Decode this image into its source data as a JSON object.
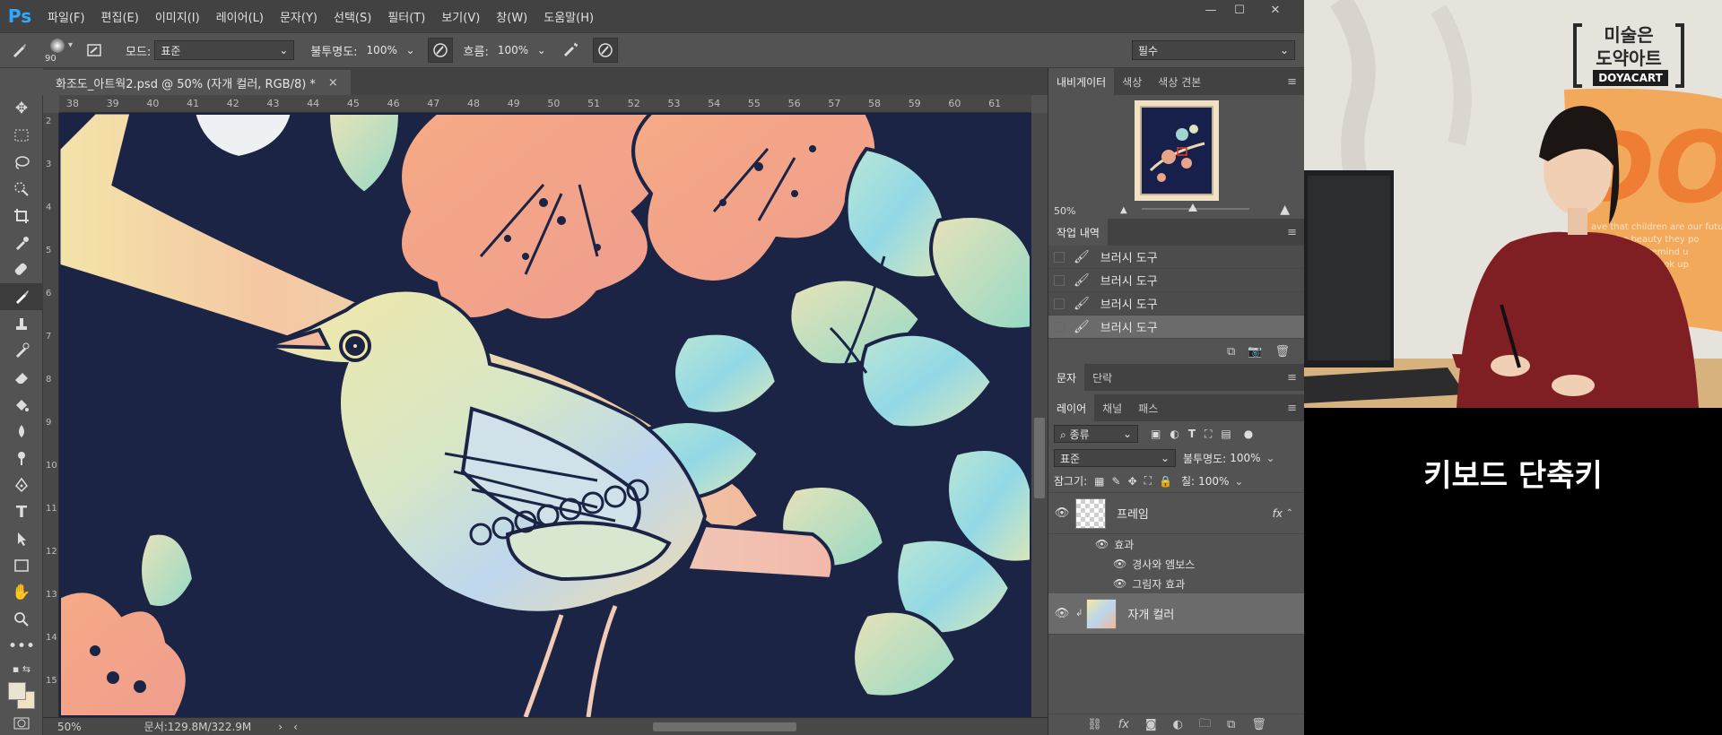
{
  "app": {
    "logo": "Ps"
  },
  "menu": [
    "파일(F)",
    "편집(E)",
    "이미지(I)",
    "레이어(L)",
    "문자(Y)",
    "선택(S)",
    "필터(T)",
    "보기(V)",
    "창(W)",
    "도움말(H)"
  ],
  "window_controls": {
    "minimize": "—",
    "restore": "☐",
    "close": "✕"
  },
  "options": {
    "brush_size": "90",
    "mode_label": "모드:",
    "mode_value": "표준",
    "opacity_label": "불투명도:",
    "opacity_value": "100%",
    "flow_label": "흐름:",
    "flow_value": "100%",
    "workspace": "필수"
  },
  "document_tab": {
    "title": "화조도_아트웍2.psd @ 50% (자개 컬러, RGB/8) *",
    "close": "×"
  },
  "ruler_top": [
    "38",
    "39",
    "40",
    "41",
    "42",
    "43",
    "44",
    "45",
    "46",
    "47",
    "48",
    "49",
    "50",
    "51",
    "52",
    "53",
    "54",
    "55",
    "56",
    "57",
    "58",
    "59",
    "60",
    "61"
  ],
  "ruler_left": [
    "2",
    "3",
    "4",
    "5",
    "6",
    "7",
    "8",
    "9",
    "10",
    "11",
    "12",
    "13",
    "14",
    "15"
  ],
  "status": {
    "zoom": "50%",
    "doc_label": "문서:",
    "doc_size": "129.8M/322.9M"
  },
  "navigator": {
    "tabs": [
      "내비게이터",
      "색상",
      "색상 견본"
    ],
    "zoom": "50%"
  },
  "history": {
    "tabs": [
      "작업 내역"
    ],
    "items": [
      "브러시 도구",
      "브러시 도구",
      "브러시 도구",
      "브러시 도구"
    ]
  },
  "text_panel": {
    "tabs": [
      "문자",
      "단락"
    ]
  },
  "layers": {
    "tabs": [
      "레이어",
      "채널",
      "패스"
    ],
    "kind_label": "종류",
    "blend_mode": "표준",
    "opacity_label": "불투명도:",
    "opacity_value": "100%",
    "lock_label": "잠그기:",
    "fill_label": "칠:",
    "fill_value": "100%",
    "items": [
      {
        "name": "프레임",
        "fx": "fx"
      },
      {
        "name": "자개 컬러"
      }
    ],
    "effects_label": "효과",
    "effects": [
      "경사와 엠보스",
      "그림자 효과"
    ]
  },
  "webcam": {
    "logo_line1": "미술은",
    "logo_line2": "도약아트",
    "logo_brand": "DOYACART"
  },
  "caption": {
    "title": "키보드 단축키"
  },
  "colors": {
    "canvas_bg": "#141d3e",
    "ps_blue": "#31a8ff",
    "panel_bg": "#535353"
  }
}
